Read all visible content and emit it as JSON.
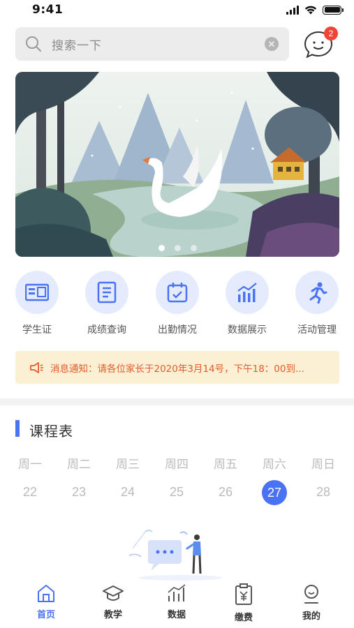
{
  "status_bar": {
    "time": "9:41"
  },
  "search": {
    "placeholder": "搜索一下"
  },
  "messages": {
    "badge_count": "2"
  },
  "banner": {
    "slides": 3,
    "active_slide": 1
  },
  "shortcuts": [
    {
      "label": "学生证",
      "icon": "student-id-icon"
    },
    {
      "label": "成绩查询",
      "icon": "grades-icon"
    },
    {
      "label": "出勤情况",
      "icon": "attendance-icon"
    },
    {
      "label": "数据展示",
      "icon": "data-chart-icon"
    },
    {
      "label": "活动管理",
      "icon": "running-icon"
    }
  ],
  "notice": {
    "text": "消息通知：请各位家长于2020年3月14号，下午18：00到..."
  },
  "schedule": {
    "title": "课程表",
    "weekdays": [
      "周一",
      "周二",
      "周三",
      "周四",
      "周五",
      "周六",
      "周日"
    ],
    "dates": [
      "22",
      "23",
      "24",
      "25",
      "26",
      "27",
      "28"
    ],
    "selected_date": "27"
  },
  "tabbar": [
    {
      "label": "首页",
      "icon": "home-icon",
      "active": true
    },
    {
      "label": "教学",
      "icon": "graduation-cap-icon",
      "active": false
    },
    {
      "label": "数据",
      "icon": "bar-chart-icon",
      "active": false
    },
    {
      "label": "缴费",
      "icon": "payment-icon",
      "active": false
    },
    {
      "label": "我的",
      "icon": "profile-icon",
      "active": false
    }
  ],
  "colors": {
    "accent": "#4a72f5",
    "badge": "#f24436",
    "notice_bg": "#fbf0d4",
    "notice_text": "#e35a2c"
  }
}
